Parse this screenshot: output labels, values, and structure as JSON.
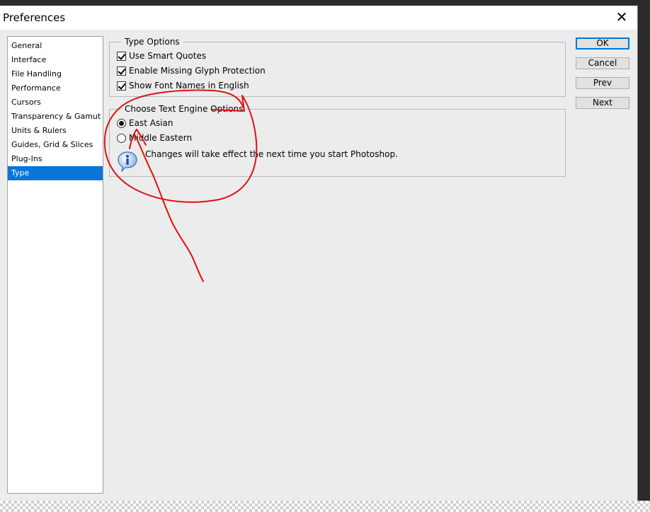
{
  "window": {
    "title": "Preferences",
    "close_glyph": "✕"
  },
  "sidebar": {
    "items": [
      {
        "label": "General",
        "selected": false
      },
      {
        "label": "Interface",
        "selected": false
      },
      {
        "label": "File Handling",
        "selected": false
      },
      {
        "label": "Performance",
        "selected": false
      },
      {
        "label": "Cursors",
        "selected": false
      },
      {
        "label": "Transparency & Gamut",
        "selected": false
      },
      {
        "label": "Units & Rulers",
        "selected": false
      },
      {
        "label": "Guides, Grid & Slices",
        "selected": false
      },
      {
        "label": "Plug-Ins",
        "selected": false
      },
      {
        "label": "Type",
        "selected": true
      }
    ]
  },
  "type_options": {
    "title": "Type Options",
    "use_smart_quotes": "Use Smart Quotes",
    "enable_missing_glyph": "Enable Missing Glyph Protection",
    "show_font_names": "Show Font Names in English",
    "use_smart_quotes_checked": true,
    "enable_missing_glyph_checked": true,
    "show_font_names_checked": true
  },
  "text_engine": {
    "title": "Choose Text Engine Options",
    "east_asian": "East Asian",
    "middle_eastern": "Middle Eastern",
    "selected": "East Asian",
    "info": "Changes will take effect the next time you start Photoshop."
  },
  "buttons": {
    "ok": "OK",
    "cancel": "Cancel",
    "prev": "Prev",
    "next": "Next"
  },
  "colors": {
    "selection": "#0a75d6",
    "annotation": "#e01010",
    "dialog_bg": "#ececec"
  }
}
